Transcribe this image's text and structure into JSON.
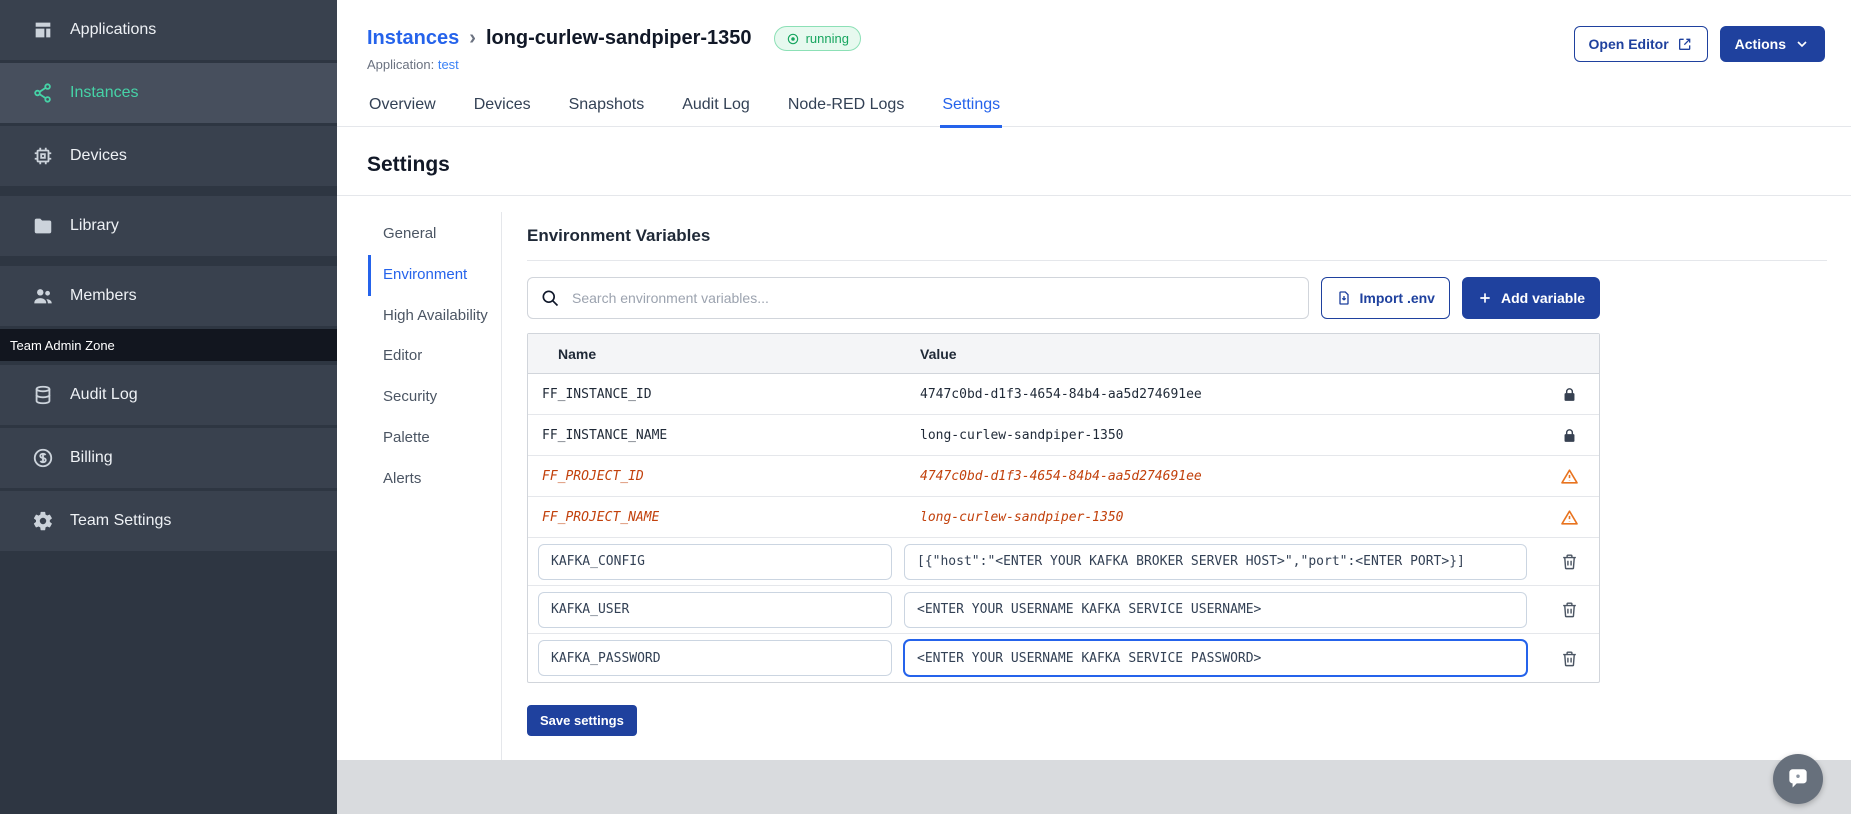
{
  "colors": {
    "primary_button": "#1f419e",
    "link_blue": "#2563eb",
    "sidebar_active": "#46d3a7",
    "deprecated_orange": "#c2410c",
    "running_green": "#17a55f"
  },
  "sidebar": {
    "items": [
      {
        "label": "Applications",
        "icon": "applications-icon"
      },
      {
        "label": "Instances",
        "icon": "instances-icon",
        "active": true
      },
      {
        "label": "Devices",
        "icon": "chip-icon"
      },
      {
        "label": "Library",
        "icon": "folder-icon"
      },
      {
        "label": "Members",
        "icon": "users-icon"
      }
    ],
    "admin_zone_label": "Team Admin Zone",
    "admin_items": [
      {
        "label": "Audit Log",
        "icon": "database-icon"
      },
      {
        "label": "Billing",
        "icon": "dollar-icon"
      },
      {
        "label": "Team Settings",
        "icon": "gear-icon"
      }
    ]
  },
  "header": {
    "breadcrumb": "Instances",
    "breadcrumb_separator": "›",
    "title": "long-curlew-sandpiper-1350",
    "status": "running",
    "application_label": "Application:",
    "application_name": "test",
    "open_editor_label": "Open Editor",
    "actions_label": "Actions"
  },
  "tabs": {
    "items": [
      "Overview",
      "Devices",
      "Snapshots",
      "Audit Log",
      "Node-RED Logs",
      "Settings"
    ],
    "active": "Settings"
  },
  "settings": {
    "heading": "Settings",
    "nav": [
      "General",
      "Environment",
      "High Availability",
      "Editor",
      "Security",
      "Palette",
      "Alerts"
    ],
    "active_nav": "Environment"
  },
  "env": {
    "title": "Environment Variables",
    "search_placeholder": "Search environment variables...",
    "import_label": "Import .env",
    "add_label": "Add variable",
    "save_label": "Save settings",
    "columns": {
      "name": "Name",
      "value": "Value"
    },
    "rows": [
      {
        "name": "FF_INSTANCE_ID",
        "value": "4747c0bd-d1f3-4654-84b4-aa5d274691ee",
        "type": "locked"
      },
      {
        "name": "FF_INSTANCE_NAME",
        "value": "long-curlew-sandpiper-1350",
        "type": "locked"
      },
      {
        "name": "FF_PROJECT_ID",
        "value": "4747c0bd-d1f3-4654-84b4-aa5d274691ee",
        "type": "deprecated"
      },
      {
        "name": "FF_PROJECT_NAME",
        "value": "long-curlew-sandpiper-1350",
        "type": "deprecated"
      },
      {
        "name": "KAFKA_CONFIG",
        "value": "[{\"host\":\"<ENTER YOUR KAFKA BROKER SERVER HOST>\",\"port\":<ENTER PORT>}]",
        "type": "editable"
      },
      {
        "name": "KAFKA_USER",
        "value": "<ENTER YOUR USERNAME KAFKA SERVICE USERNAME>",
        "type": "editable"
      },
      {
        "name": "KAFKA_PASSWORD",
        "value": "<ENTER YOUR USERNAME KAFKA SERVICE PASSWORD>",
        "type": "editable",
        "focused": true
      }
    ]
  }
}
